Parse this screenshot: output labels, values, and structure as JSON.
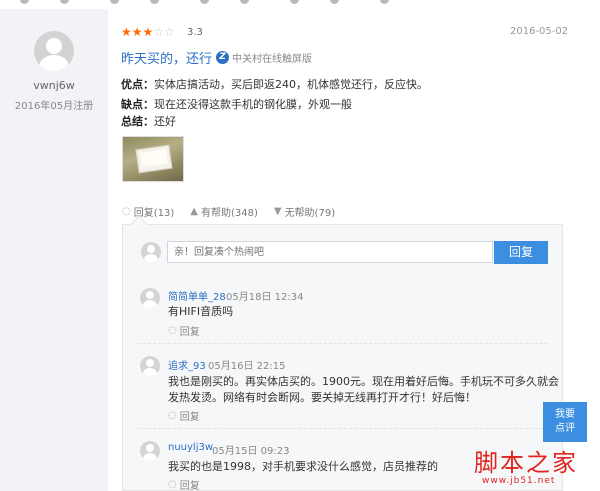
{
  "review": {
    "user": {
      "name": "vwnj6w",
      "registered": "2016年05月注册"
    },
    "stars_filled": "★★★",
    "stars_empty": "☆☆",
    "rating": "3.3",
    "date": "2016-05-02",
    "title": "昨天买的，还行",
    "source": "中关村在线触屏版",
    "pros_label": "优点：",
    "pros": "实体店搞活动，买后即返240，机体感觉还行，反应快。",
    "cons_label": "缺点：",
    "cons": "现在还没得这款手机的钢化膜，外观一般",
    "summary_label": "总结：",
    "summary": "还好",
    "actions": {
      "reply": "回复(13)",
      "helpful": "有帮助(348)",
      "unhelpful": "无帮助(79)"
    }
  },
  "reply_box": {
    "placeholder": "亲！回复凑个热闹吧",
    "button": "回复"
  },
  "comments": [
    {
      "user": "简简单单_28",
      "time": "05月18日 12:34",
      "text": "有HIFI音质吗",
      "reply": "回复"
    },
    {
      "user": "追求_93",
      "time": "05月16日 22:15",
      "text": "我也是刚买的。再实体店买的。1900元。现在用着好后悔。手机玩不可多久就会发热发烫。网络有时会断网。要关掉无线再打开才行！好后悔！",
      "reply": "回复"
    },
    {
      "user": "nuuylj3w",
      "time": "05月15日 09:23",
      "text": "我买的也是1998，对手机要求没什么感觉，店员推荐的",
      "reply": "回复"
    }
  ],
  "float_button": {
    "line1": "我要",
    "line2": "点评"
  },
  "watermark": {
    "main": "脚本之家",
    "url": "www.jb51.net"
  },
  "colors": {
    "accent": "#3b8ee0",
    "link": "#2b6fc5",
    "star": "#ff6a00",
    "watermark": "#e0241f"
  }
}
